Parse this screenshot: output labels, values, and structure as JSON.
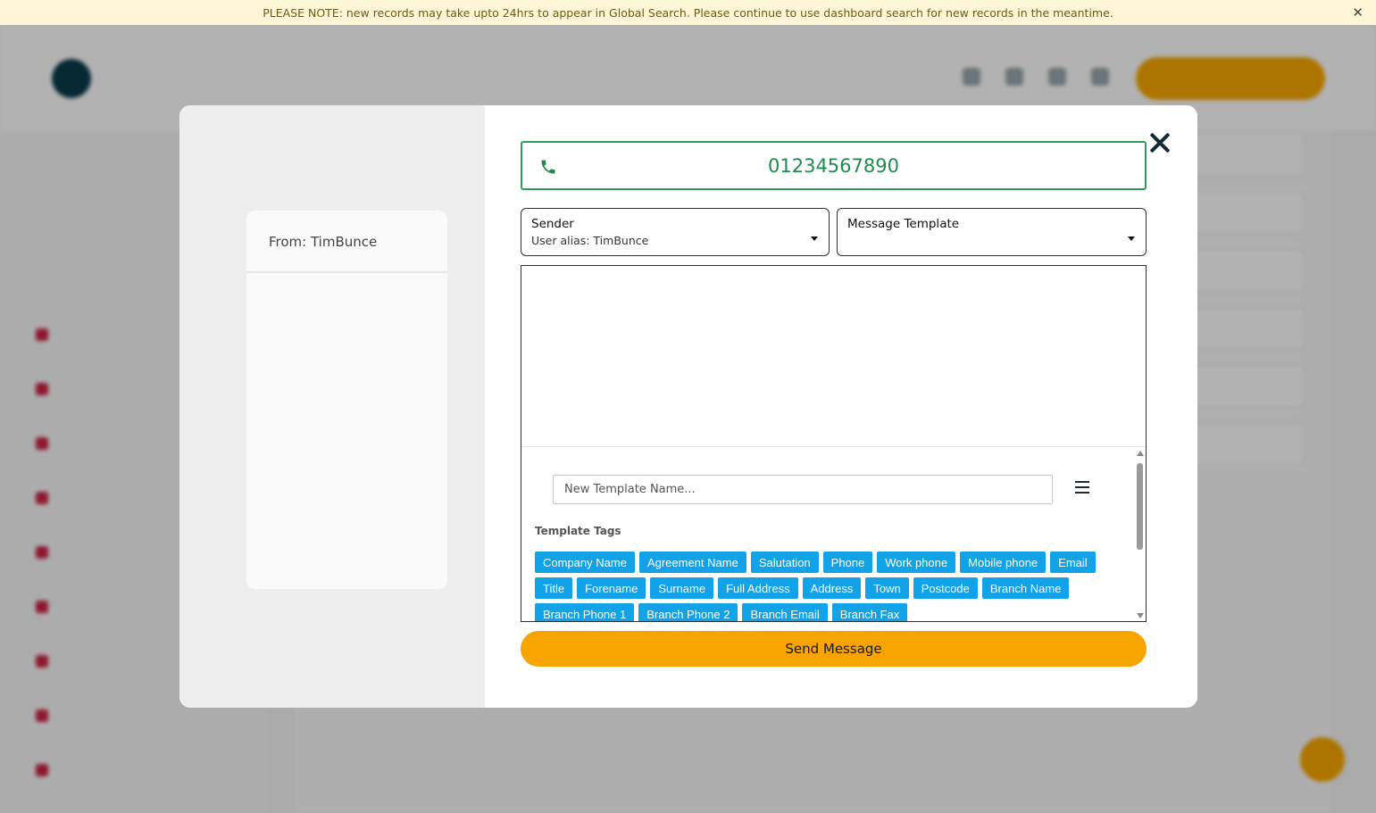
{
  "notice": {
    "text": "PLEASE NOTE: new records may take upto 24hrs to appear in Global Search. Please continue to use dashboard search for new records in the meantime.",
    "close_icon": "close-icon"
  },
  "modal": {
    "preview": {
      "from_text": "From: TimBunce"
    },
    "phone": {
      "icon": "phone-icon",
      "number": "01234567890"
    },
    "sender": {
      "label": "Sender",
      "value": "User alias: TimBunce"
    },
    "message_template": {
      "label": "Message Template",
      "value": ""
    },
    "template": {
      "name_placeholder": "New Template Name...",
      "menu_icon": "hamburger-menu-icon",
      "tags_title": "Template Tags",
      "tags": [
        "Company Name",
        "Agreement Name",
        "Salutation",
        "Phone",
        "Work phone",
        "Mobile phone",
        "Email",
        "Title",
        "Forename",
        "Surname",
        "Full Address",
        "Address",
        "Town",
        "Postcode",
        "Branch Name",
        "Branch Phone 1",
        "Branch Phone 2",
        "Branch Email",
        "Branch Fax"
      ]
    },
    "send_label": "Send Message",
    "close_icon": "close-icon"
  },
  "colors": {
    "accent": "#f8a400",
    "tag": "#12a2e8",
    "phone": "#1f8a4c",
    "notice_bg": "#fff6d8"
  }
}
